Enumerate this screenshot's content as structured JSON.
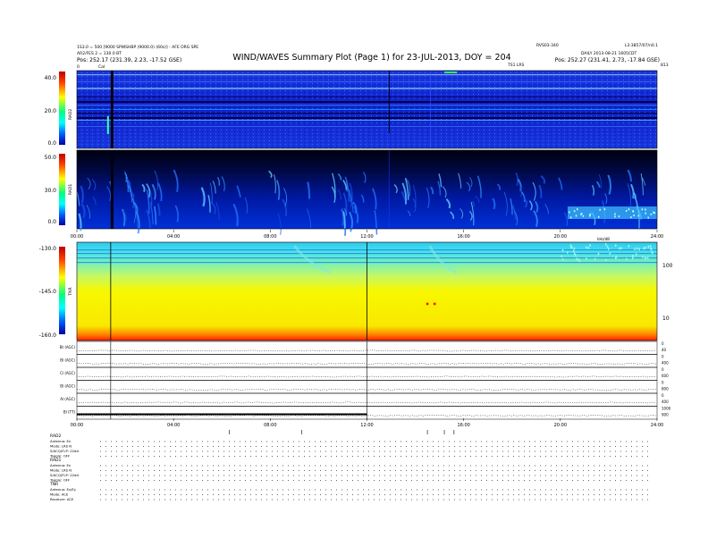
{
  "header": {
    "title": "WIND/WAVES Summary Plot (Page 1) for 23-JUL-2013, DOY = 204",
    "left_line1": "1S3.0 = 500 [9000 SPWSHBP (9000.0) (60s)] - AFE ORG SPE",
    "left_line2": "AR2/FES 2 = 130.0 BT",
    "left_line3": "Pos: 252.17 (231.39, 2.23, -17.52 GSE)",
    "right_top_left": "RVS03-340",
    "right_top_right": "L3:3857/07/n0.1",
    "right_line2": "DAILY 2013-08-21 1605CDT",
    "right_line3": "Pos: 252.27 (231.41, 2.73, -17.84 GSE)",
    "sublabel_left": "0",
    "sublabel_cal": "Cal",
    "sublabel_mid": "TS1 LRS",
    "sublabel_right": "813"
  },
  "rad2": {
    "name": "RAD2",
    "ticks": [
      "40.0",
      "20.0",
      "0.0"
    ]
  },
  "rad1": {
    "name": "RAD1",
    "ticks": [
      "50.0",
      "30.0",
      "0.0"
    ]
  },
  "time_ticks": [
    "00:00",
    "04:00",
    "08:00",
    "12:00",
    "16:00",
    "20:00",
    "24:00"
  ],
  "tnr": {
    "name": "TNR",
    "ticks": [
      "-130.0",
      "-145.0",
      "-160.0"
    ],
    "right_ticks": [
      "100",
      "10"
    ],
    "right_label": "kHz/dB"
  },
  "lines": [
    {
      "label": "Bt (AGC)",
      "r1": "0",
      "r2": "40"
    },
    {
      "label": "Bl (AGC)",
      "r1": "0",
      "r2": "400"
    },
    {
      "label": "Cl (AGC)",
      "r1": "0",
      "r2": "600"
    },
    {
      "label": "Bl (AGC)",
      "r1": "0",
      "r2": "800"
    },
    {
      "label": "Al (AGC)",
      "r1": "0",
      "r2": "400"
    },
    {
      "label": "Bl (TT)",
      "r1": "1000",
      "r2": "900"
    }
  ],
  "footer": {
    "rad2_header": "RAD2",
    "rad2_rows": [
      "Antenna: Ex",
      "Mode: LRS N",
      "S/ACQ/FLP: 22dd",
      "Toggle: OFF"
    ],
    "rad1_header": "RAD1",
    "rad1_rows": [
      "Antenna: Ex",
      "Mode: LRS N",
      "S/ACQ/FLP: 22dd",
      "Toggle: OFF"
    ],
    "tnr_header": "TNR",
    "tnr_rows": [
      "Antenna: Ex/Ey",
      "Mode: ACE",
      "Receiver: ACE"
    ]
  },
  "colors": {
    "colorbar_top": "#c00000",
    "colorbar_mid": "#ffff00",
    "colorbar_low": "#00ffff",
    "colorbar_bottom": "#0000a0",
    "rad_background": "#1028d8",
    "rad1_dark": "#000018",
    "tnr_cyan": "#48e8f0",
    "tnr_yellow": "#f8f000",
    "tnr_red": "#ff2000"
  },
  "chart_data": [
    {
      "type": "heatmap",
      "title": "WIND/WAVES Summary Plot (Page 1) for 23-JUL-2013, DOY = 204",
      "panel": "RAD2",
      "xlabel": "",
      "ylabel": "RAD2",
      "xlim": [
        "00:00",
        "24:00"
      ],
      "yticks": [
        40.0,
        20.0,
        0.0
      ],
      "grid": false
    },
    {
      "type": "heatmap",
      "panel": "RAD1",
      "xlabel": "",
      "ylabel": "RAD1",
      "xlim": [
        "00:00",
        "24:00"
      ],
      "xticks": [
        "00:00",
        "04:00",
        "08:00",
        "12:00",
        "16:00",
        "20:00",
        "24:00"
      ],
      "yticks": [
        50.0,
        30.0,
        0.0
      ],
      "grid": false
    },
    {
      "type": "heatmap",
      "panel": "TNR",
      "xlabel": "",
      "ylabel": "TNR",
      "xlim": [
        "00:00",
        "24:00"
      ],
      "yticks": [
        -130.0,
        -145.0,
        -160.0
      ],
      "right_axis_ticks": [
        100,
        10
      ],
      "grid": false
    },
    {
      "type": "line",
      "panel": "AGC stack",
      "xticks": [
        "00:00",
        "04:00",
        "08:00",
        "12:00",
        "16:00",
        "20:00",
        "24:00"
      ],
      "series": [
        {
          "name": "Bt (AGC)",
          "x": [
            0,
            24
          ],
          "y": [
            0.5,
            0.5
          ]
        },
        {
          "name": "Bl (AGC)",
          "x": [
            0,
            24
          ],
          "y": [
            0.5,
            0.5
          ]
        },
        {
          "name": "Cl (AGC)",
          "x": [
            0,
            24
          ],
          "y": [
            0.5,
            0.5
          ]
        },
        {
          "name": "Bl (AGC)",
          "x": [
            0,
            24
          ],
          "y": [
            0.5,
            0.5
          ]
        },
        {
          "name": "Al (AGC)",
          "x": [
            0,
            24
          ],
          "y": [
            0.5,
            0.5
          ]
        },
        {
          "name": "Bl (TT)",
          "x": [
            0,
            24
          ],
          "y": [
            0.5,
            0.5
          ]
        }
      ]
    }
  ]
}
